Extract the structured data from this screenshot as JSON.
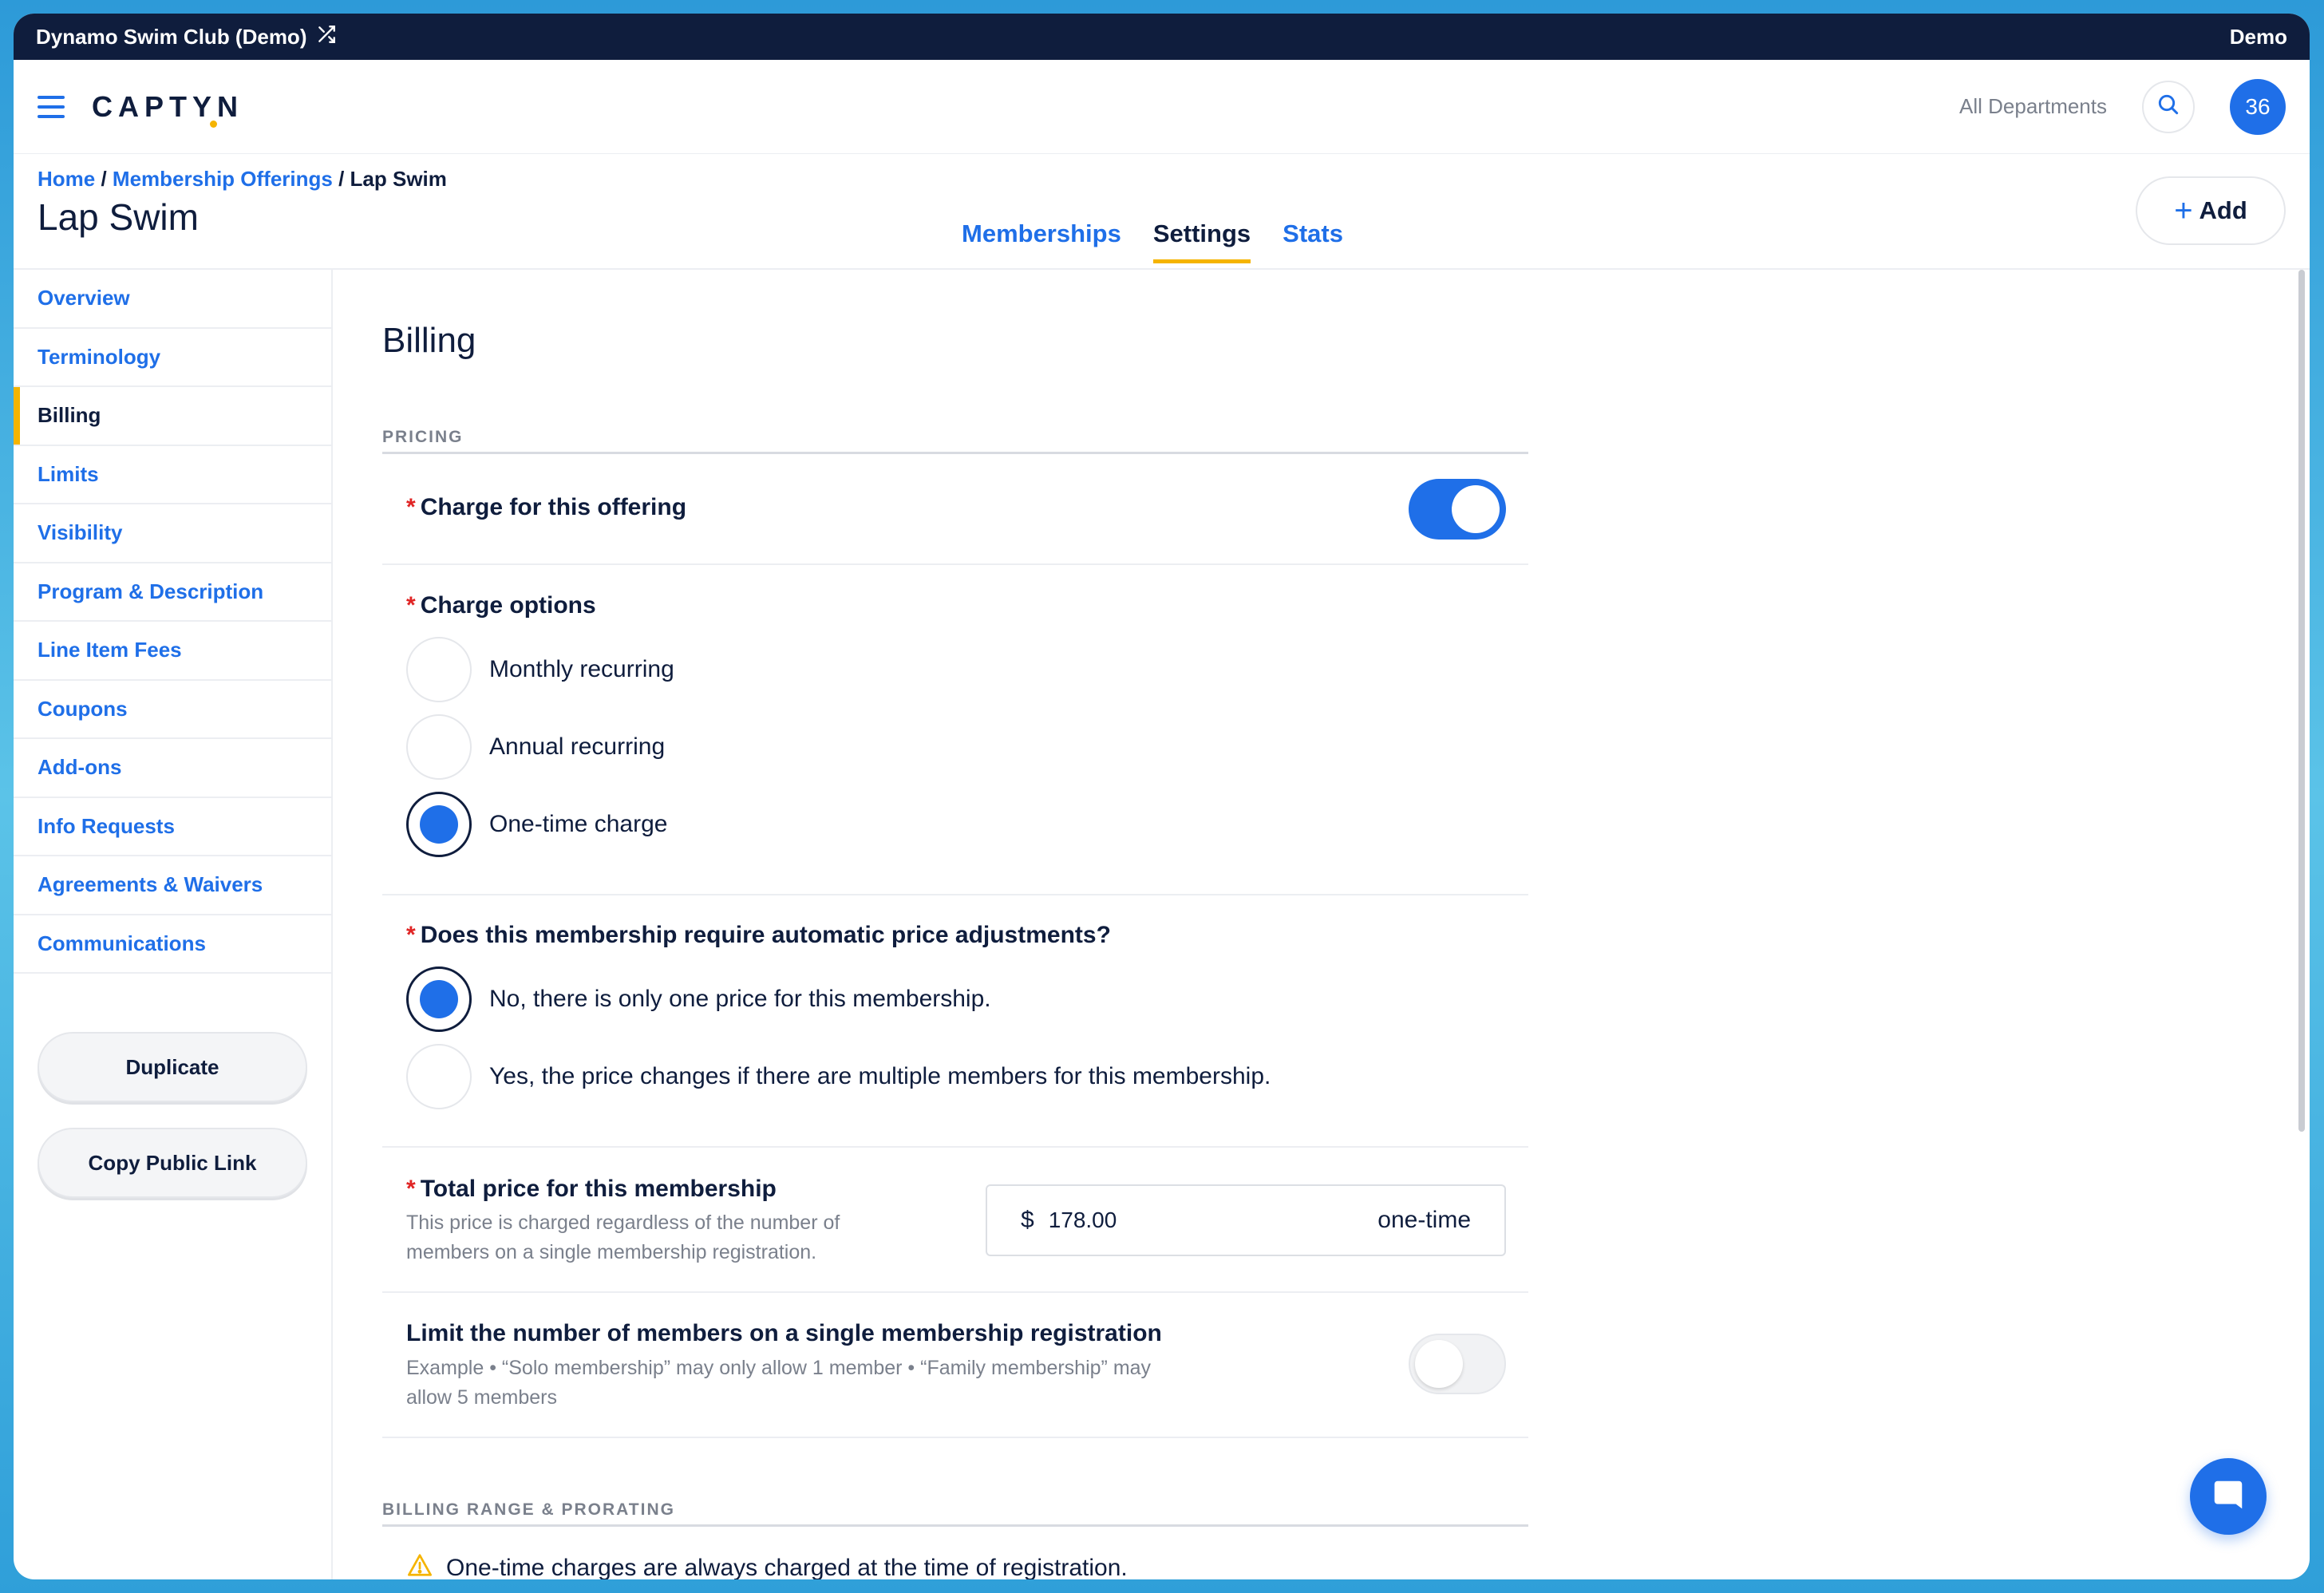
{
  "topbar": {
    "club_name": "Dynamo Swim Club (Demo)",
    "demo_label": "Demo"
  },
  "header": {
    "logo": "CAPTYN",
    "department": "All Departments",
    "avatar_count": "36"
  },
  "breadcrumb": {
    "home": "Home",
    "sep1": " / ",
    "offerings": "Membership Offerings",
    "sep2": " / ",
    "current": "Lap Swim"
  },
  "page": {
    "title": "Lap Swim",
    "add_label": "Add"
  },
  "tabs": [
    {
      "label": "Memberships",
      "active": false
    },
    {
      "label": "Settings",
      "active": true
    },
    {
      "label": "Stats",
      "active": false
    }
  ],
  "sidebar": {
    "items": [
      {
        "label": "Overview"
      },
      {
        "label": "Terminology"
      },
      {
        "label": "Billing",
        "active": true
      },
      {
        "label": "Limits"
      },
      {
        "label": "Visibility"
      },
      {
        "label": "Program & Description"
      },
      {
        "label": "Line Item Fees"
      },
      {
        "label": "Coupons"
      },
      {
        "label": "Add-ons"
      },
      {
        "label": "Info Requests"
      },
      {
        "label": "Agreements & Waivers"
      },
      {
        "label": "Communications"
      }
    ],
    "duplicate_label": "Duplicate",
    "copy_link_label": "Copy Public Link"
  },
  "billing": {
    "title": "Billing",
    "pricing_heading": "PRICING",
    "charge_label": "Charge for this offering",
    "charge_enabled": true,
    "charge_options_label": "Charge options",
    "charge_options": [
      {
        "label": "Monthly recurring",
        "checked": false
      },
      {
        "label": "Annual recurring",
        "checked": false
      },
      {
        "label": "One-time charge",
        "checked": true
      }
    ],
    "adjust_label": "Does this membership require automatic price adjustments?",
    "adjust_options": [
      {
        "label": "No, there is only one price for this membership.",
        "checked": true
      },
      {
        "label": "Yes, the price changes if there are multiple members for this membership.",
        "checked": false
      }
    ],
    "total_label": "Total price for this membership",
    "total_help_1": "This price is charged regardless of the number of",
    "total_help_2": "members on a single membership registration.",
    "currency": "$",
    "price": "178.00",
    "price_unit": "one-time",
    "limit_label": "Limit the number of members on a single membership registration",
    "limit_help_1": "Example • “Solo membership” may only allow 1 member • “Family membership” may",
    "limit_help_2": "allow 5 members",
    "limit_enabled": false,
    "range_heading": "BILLING RANGE & PRORATING",
    "warning": "One-time charges are always charged at the time of registration."
  },
  "colors": {
    "accent": "#1f6fe8",
    "navy": "#0f1d3d",
    "highlight": "#f5b400"
  }
}
